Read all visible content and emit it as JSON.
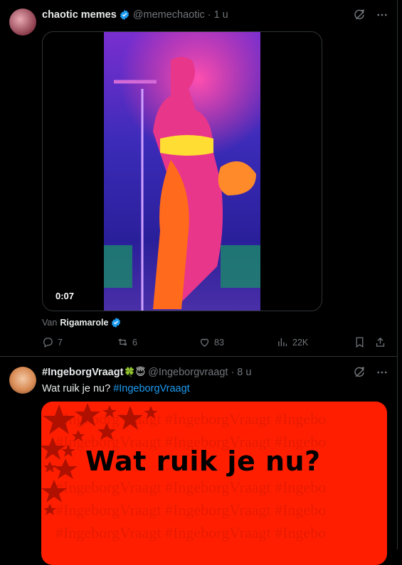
{
  "tweets": [
    {
      "display_name": "chaotic memes",
      "verified": true,
      "handle": "@memechaotic",
      "time": "· 1 u",
      "video": {
        "duration": "0:07"
      },
      "attribution": {
        "prefix": "Van",
        "name": "Rigamarole",
        "verified": true
      },
      "actions": {
        "replies": "7",
        "reposts": "6",
        "likes": "83",
        "views": "22K"
      }
    },
    {
      "display_name": "#IngeborgVraagt",
      "emoji": "🍀😇",
      "handle": "@Ingeborgvraagt",
      "time": "· 8 u",
      "text_prefix": "Wat ruik je nu?",
      "text_hashtag": "#IngeborgVraagt",
      "image": {
        "headline": "Wat ruik je nu?"
      }
    }
  ],
  "colors": {
    "accent": "#1d9bf0",
    "muted": "#71767b",
    "image_bg": "#ff1f00"
  },
  "icons": [
    "grok-icon",
    "more-icon",
    "reply-icon",
    "repost-icon",
    "like-icon",
    "views-icon",
    "bookmark-icon",
    "share-icon",
    "verified-badge-icon"
  ]
}
